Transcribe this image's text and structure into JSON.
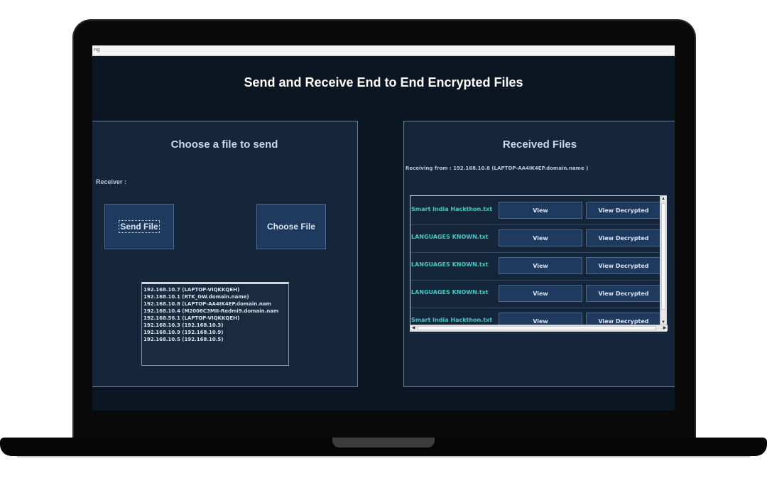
{
  "window": {
    "title_icon": "ng",
    "app_title": "Send and Receive End to End Encrypted Files"
  },
  "send_panel": {
    "title": "Choose a file to send",
    "receiver_label": "Receiver :",
    "send_button": "Send File",
    "choose_button": "Choose File",
    "receivers": [
      "192.168.10.7 (LAPTOP-VIQKKQEH)",
      "192.168.10.1 (RTK_GW.domain.name)",
      "192.168.10.8 (LAPTOP-AA4IK4EP.domain.nam",
      "192.168.10.4 (M2006C3MII-Redmi9.domain.nam",
      "192.168.56.1 (LAPTOP-VIQKKQEH)",
      "192.168.10.3 (192.168.10.3)",
      "192.168.10.9 (192.168.10.9)",
      "192.168.10.5 (192.168.10.5)"
    ]
  },
  "receive_panel": {
    "title": "Received Files",
    "receiving_from": "Receiving from : 192.168.10.8 (LAPTOP-AA4IK4EP.domain.name )",
    "view_label": "View",
    "view_decrypted_label": "View Decrypted",
    "files": [
      "Smart India Hackthon.txt",
      "LANGUAGES KNOWN.txt",
      "LANGUAGES KNOWN.txt",
      "LANGUAGES KNOWN.txt",
      "Smart India Hackthon.txt"
    ]
  },
  "icons": {
    "scroll_up": "▲",
    "scroll_down": "▼",
    "scroll_left": "◀",
    "scroll_right": "▶"
  }
}
